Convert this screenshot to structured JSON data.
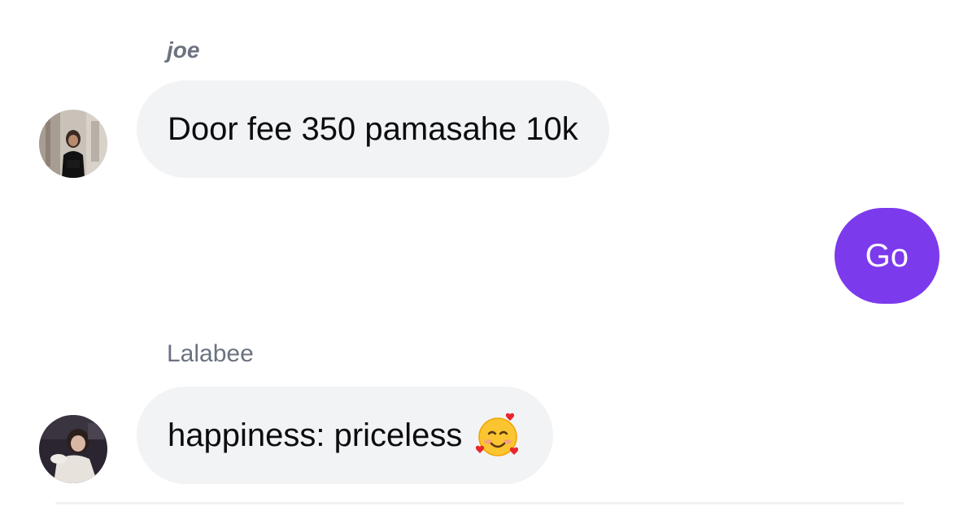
{
  "messages": [
    {
      "sender": "joe",
      "text": "Door fee 350 pamasahe 10k",
      "direction": "incoming"
    },
    {
      "text": "Go",
      "direction": "outgoing"
    },
    {
      "sender": "Lalabee",
      "text": "happiness: priceless",
      "emoji": "smiling-face-with-hearts-icon",
      "direction": "incoming"
    }
  ],
  "colors": {
    "incoming_bubble": "#f2f3f5",
    "outgoing_bubble": "#7c3aed",
    "sender_name": "#6b7280"
  }
}
